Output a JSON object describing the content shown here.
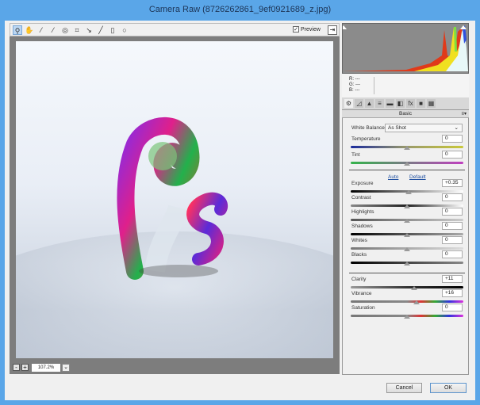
{
  "window": {
    "title": "Camera Raw (8726262861_9ef0921689_z.jpg)"
  },
  "toolbar": {
    "tools": [
      {
        "name": "zoom-tool-icon",
        "glyph": "⚲"
      },
      {
        "name": "hand-tool-icon",
        "glyph": "✋"
      },
      {
        "name": "white-balance-tool-icon",
        "glyph": "⁄"
      },
      {
        "name": "color-sampler-tool-icon",
        "glyph": "⁄"
      },
      {
        "name": "targeted-adjustment-tool-icon",
        "glyph": "◎"
      },
      {
        "name": "crop-tool-icon",
        "glyph": "⌗"
      },
      {
        "name": "straighten-tool-icon",
        "glyph": "↘"
      },
      {
        "name": "spot-removal-tool-icon",
        "glyph": "╱"
      },
      {
        "name": "red-eye-tool-icon",
        "glyph": "▯"
      },
      {
        "name": "adjustment-brush-icon",
        "glyph": "○"
      }
    ],
    "preview_label": "Preview",
    "preview_checked": true
  },
  "zoom": {
    "value": "107.2%",
    "minus": "-",
    "plus": "+"
  },
  "readout": {
    "r": "R:  ---",
    "g": "G:  ---",
    "b": "B:  ---"
  },
  "panel_tabs": [
    "⚙",
    "◿",
    "▲",
    "≡",
    "▬",
    "◧",
    "fx",
    "■",
    "▦"
  ],
  "panel": {
    "header": "Basic",
    "white_balance_label": "White Balance:",
    "white_balance_value": "As Shot",
    "auto": "Auto",
    "default": "Default"
  },
  "sliders": [
    {
      "label": "Temperature",
      "value": "0",
      "gradient": "linear-gradient(90deg,#1a2a9c,#9a9a6a,#c9c83a)"
    },
    {
      "label": "Tint",
      "value": "0",
      "gradient": "linear-gradient(90deg,#33b34a,#c040c0)"
    },
    {
      "label": "Exposure",
      "value": "+0.35",
      "gradient": "linear-gradient(90deg,#000,#fff)"
    },
    {
      "label": "Contrast",
      "value": "0",
      "gradient": "linear-gradient(90deg,#888,#222 50%,#fff)"
    },
    {
      "label": "Highlights",
      "value": "0",
      "gradient": "linear-gradient(90deg,#555,#ccc)"
    },
    {
      "label": "Shadows",
      "value": "0",
      "gradient": "linear-gradient(90deg,#000,#aaa)"
    },
    {
      "label": "Whites",
      "value": "0",
      "gradient": "linear-gradient(90deg,#777,#ddd)"
    },
    {
      "label": "Blacks",
      "value": "0",
      "gradient": "linear-gradient(90deg,#000,#888)"
    },
    {
      "label": "Clarity",
      "value": "+11",
      "gradient": "linear-gradient(90deg,#999,#333 50%,#000)"
    },
    {
      "label": "Vibrance",
      "value": "+16",
      "gradient": "linear-gradient(90deg,#777,#888 50%,#d33,#3a3,#33d,#d3d)"
    },
    {
      "label": "Saturation",
      "value": "0",
      "gradient": "linear-gradient(90deg,#777,#888 50%,#d33,#3a3,#33d,#d3d)"
    }
  ],
  "buttons": {
    "cancel": "Cancel",
    "ok": "OK"
  }
}
